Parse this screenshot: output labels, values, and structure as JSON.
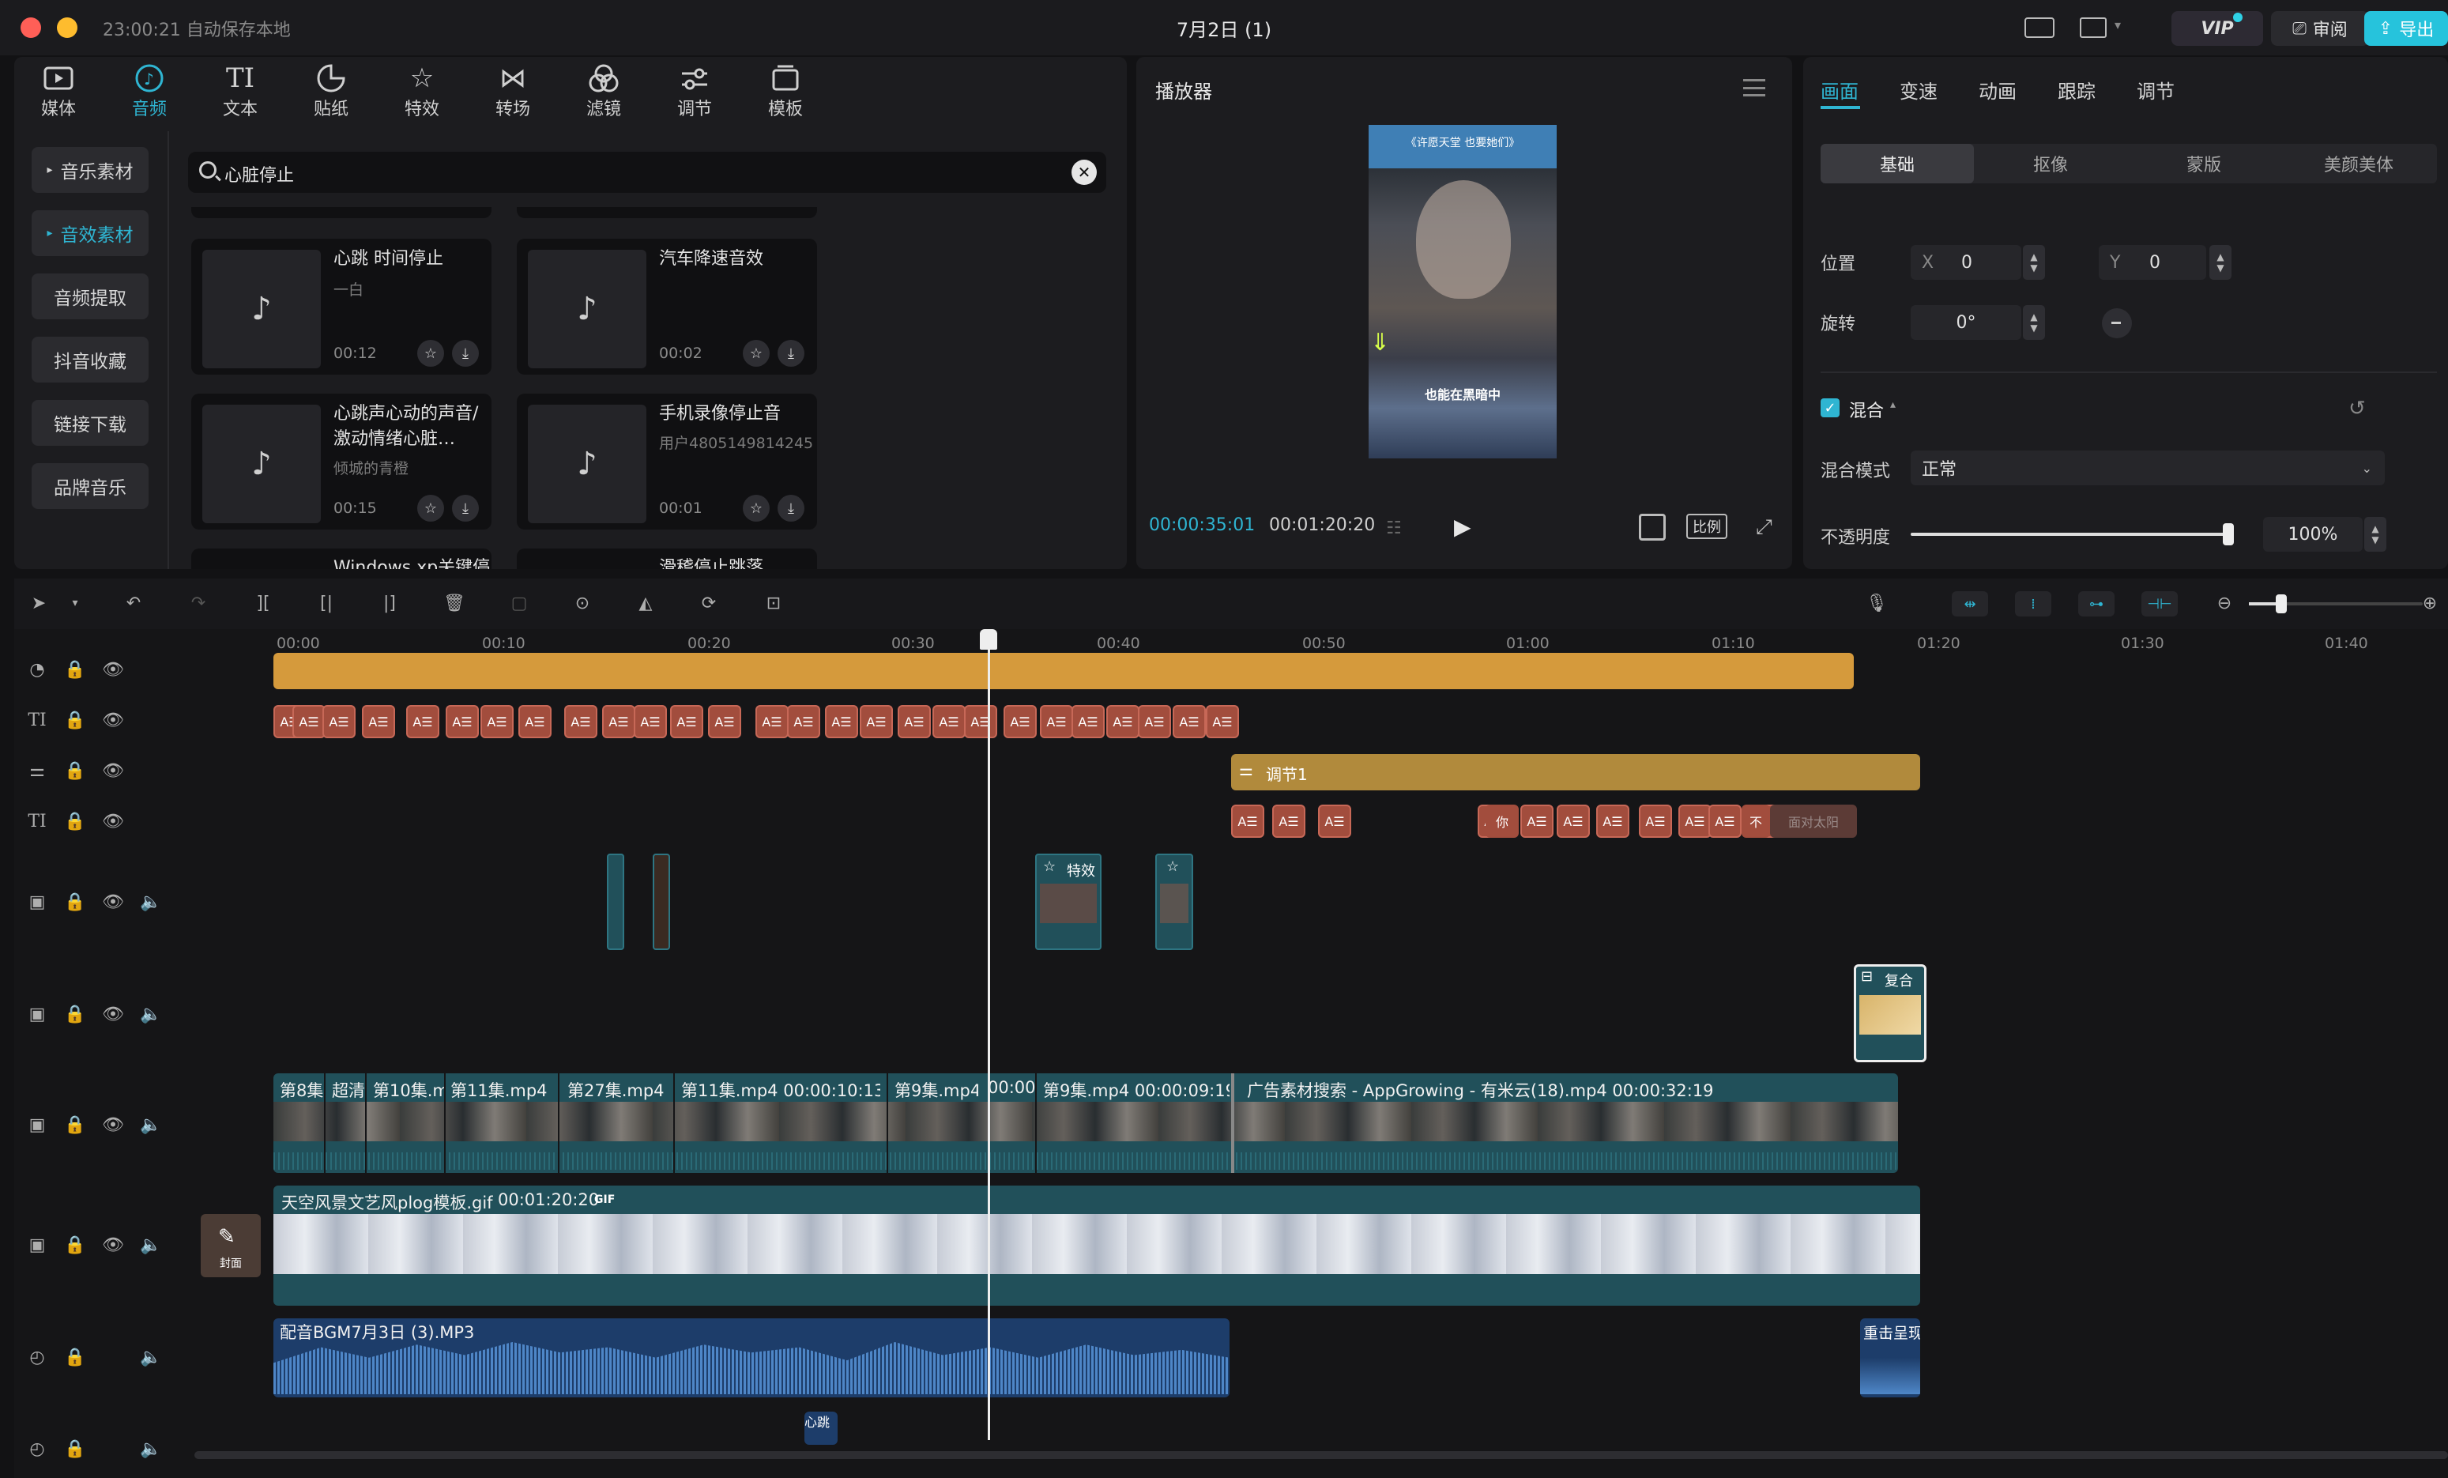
{
  "titlebar": {
    "autosave": "23:00:21 自动保存本地",
    "project_name": "7月2日 (1)",
    "vip": "VIP",
    "review": "审阅",
    "export": "导出"
  },
  "toolbar": {
    "tabs": [
      {
        "label": "媒体"
      },
      {
        "label": "音频"
      },
      {
        "label": "文本"
      },
      {
        "label": "贴纸"
      },
      {
        "label": "特效"
      },
      {
        "label": "转场"
      },
      {
        "label": "滤镜"
      },
      {
        "label": "调节"
      },
      {
        "label": "模板"
      }
    ]
  },
  "audio_sidebar": {
    "items": [
      {
        "label": "音乐素材"
      },
      {
        "label": "音效素材"
      },
      {
        "label": "音频提取"
      },
      {
        "label": "抖音收藏"
      },
      {
        "label": "链接下载"
      },
      {
        "label": "品牌音乐"
      }
    ]
  },
  "search": {
    "value": "心脏停止"
  },
  "sound_cards": [
    {
      "title": "心跳 时间停止",
      "author": "一白",
      "duration": "00:12"
    },
    {
      "title": "汽车降速音效",
      "author": "",
      "duration": "00:02"
    },
    {
      "title": "心跳声心动的声音/激动情绪心脏…",
      "author": "倾城的青橙",
      "duration": "00:15"
    },
    {
      "title": "手机录像停止音",
      "author": "用户4805149814245",
      "duration": "00:01"
    },
    {
      "title": "Windows xp关键停",
      "author": "",
      "duration": ""
    },
    {
      "title": "滑稽停止跳落",
      "author": "",
      "duration": ""
    }
  ],
  "player": {
    "title": "播放器",
    "video_top_text": "《许愿天堂 也要她们》",
    "subtitle": "也能在黑暗中",
    "current_time": "00:00:35:01",
    "total_time": "00:01:20:20",
    "ratio_label": "比例"
  },
  "props": {
    "tabs": [
      {
        "label": "画面"
      },
      {
        "label": "变速"
      },
      {
        "label": "动画"
      },
      {
        "label": "跟踪"
      },
      {
        "label": "调节"
      }
    ],
    "subtabs": [
      {
        "label": "基础"
      },
      {
        "label": "抠像"
      },
      {
        "label": "蒙版"
      },
      {
        "label": "美颜美体"
      }
    ],
    "position_label": "位置",
    "x_label": "X",
    "x_value": "0",
    "y_label": "Y",
    "y_value": "0",
    "rotate_label": "旋转",
    "rotate_value": "0°",
    "blend_label": "混合",
    "blend_mode_label": "混合模式",
    "blend_mode_value": "正常",
    "opacity_label": "不透明度",
    "opacity_value": "100%",
    "opacity_fraction": 1.0
  },
  "timeline": {
    "ruler": [
      "00:00",
      "00:10",
      "00:20",
      "00:30",
      "00:40",
      "00:50",
      "01:00",
      "01:10",
      "01:20",
      "01:30",
      "01:40"
    ],
    "text_clip_glyph": "A☰",
    "adjust_clip_label": "调节1",
    "text_row2": [
      "你",
      "不",
      "面对太阳"
    ],
    "effect_label": "特效",
    "compound_label": "复合",
    "main_clips": [
      {
        "label": "第8集"
      },
      {
        "label": "超清"
      },
      {
        "label": "第10集.m"
      },
      {
        "label": "第11集.mp4"
      },
      {
        "label": "第27集.mp4"
      },
      {
        "label": "第11集.mp4  00:00:10:13"
      },
      {
        "label": "第9集.mp4"
      },
      {
        "label": "00:00:"
      },
      {
        "label": "第9集.mp4  00:00:09:19"
      },
      {
        "label": "广告素材搜索 - AppGrowing - 有米云(18).mp4  00:00:32:19"
      }
    ],
    "gif_clip": {
      "label": "天空风景文艺风plog模板.gif",
      "duration": "00:01:20:20",
      "badge": "GIF"
    },
    "cover_label": "封面",
    "bgm_clip": {
      "label": "配音BGM7月3日 (3).MP3"
    },
    "sfx_clip": {
      "label": "重击呈现"
    },
    "small_audio": {
      "label": "心跳"
    }
  },
  "colors": {
    "accent": "#2fb5d2",
    "text_clip": "#a24d3d",
    "sticker_track": "#d59a3c",
    "adjust_track": "#b18a3c",
    "video_track": "#21505a",
    "audio_track": "#1d3d6a"
  }
}
